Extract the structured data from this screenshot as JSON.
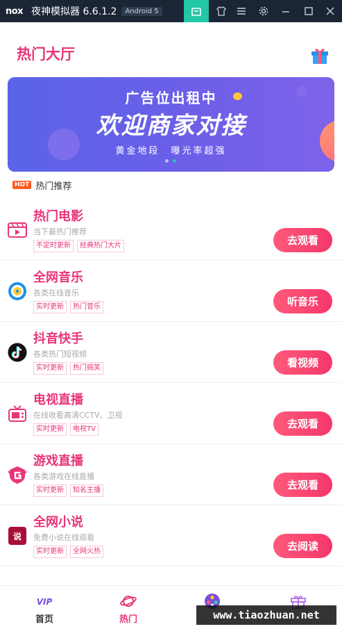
{
  "window": {
    "app_name": "夜神模拟器 6.6.1.2",
    "android_badge": "Android 5",
    "logo_text": "nox"
  },
  "header": {
    "title": "热门大厅",
    "gift_icon": "gift-icon"
  },
  "banner": {
    "line1": "广告位出租中",
    "line2": "欢迎商家对接",
    "line3": "黄金地段　曝光率超强",
    "page_count": 2,
    "active_page": 2
  },
  "section": {
    "badge": "HOT",
    "label": "热门推荐"
  },
  "items": [
    {
      "title": "热门电影",
      "desc": "当下最热门推荐",
      "tags": [
        "不定时更新",
        "经典热门大片"
      ],
      "button": "去观看",
      "icon": "movie-icon"
    },
    {
      "title": "全网音乐",
      "desc": "各类在线音乐",
      "tags": [
        "实时更新",
        "热门音乐"
      ],
      "button": "听音乐",
      "icon": "music-icon"
    },
    {
      "title": "抖音快手",
      "desc": "各类热门短视频",
      "tags": [
        "实时更新",
        "热门搞笑"
      ],
      "button": "看视频",
      "icon": "tiktok-icon"
    },
    {
      "title": "电视直播",
      "desc": "在线收看高清CCTV、卫视",
      "tags": [
        "实时更新",
        "电视TV"
      ],
      "button": "去观看",
      "icon": "tv-icon"
    },
    {
      "title": "游戏直播",
      "desc": "各类游戏在线直播",
      "tags": [
        "实时更新",
        "知名主播"
      ],
      "button": "去观看",
      "icon": "game-icon"
    },
    {
      "title": "全网小说",
      "desc": "免费小说在线观看",
      "tags": [
        "实时更新",
        "全网火热"
      ],
      "button": "去阅读",
      "icon": "novel-icon",
      "icon_text": "说"
    }
  ],
  "bottom_nav": [
    {
      "label": "首页",
      "icon": "vip-icon",
      "icon_text": "VIP",
      "active": false
    },
    {
      "label": "热门",
      "icon": "planet-icon",
      "active": true
    },
    {
      "label": "",
      "icon": "film-reel-icon",
      "active": false
    },
    {
      "label": "",
      "icon": "gift-icon",
      "active": false
    }
  ],
  "watermark": "www.tiaozhuan.net",
  "colors": {
    "accent": "#e8357a",
    "titlebar": "#1b2535",
    "nox_green": "#23c6a7",
    "banner": "#6a5fe8"
  }
}
